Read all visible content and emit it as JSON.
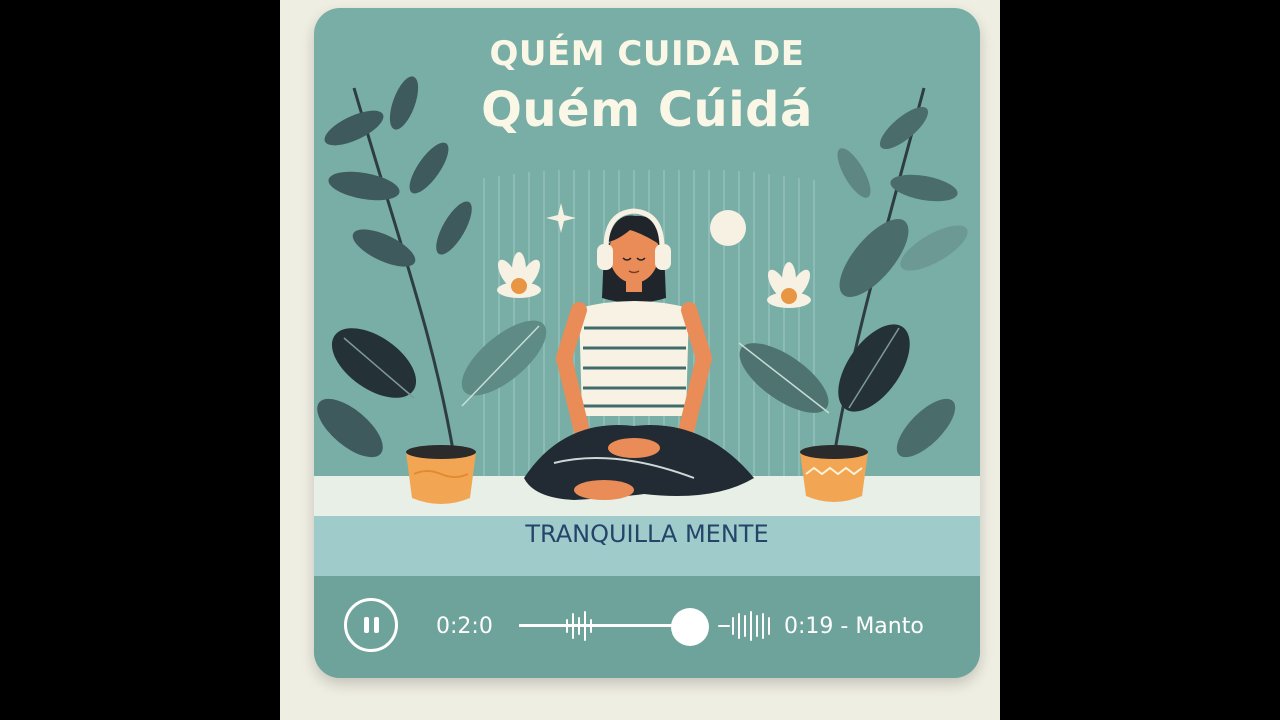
{
  "card": {
    "title_line1": "QUÉM CUIDA DE",
    "title_line2": "Quém Cúidá",
    "brand": "TRANQUILLA MENTE"
  },
  "player": {
    "current_time": "0:2:0",
    "total_time": "0:19 - Manto",
    "state_icon": "pause-icon",
    "progress_fraction": 0.68
  },
  "colors": {
    "card_bg": "#78aea6",
    "title": "#fbf7e6",
    "brand": "#24446a",
    "player_bar": "#6ea39b",
    "shirt": "#f7f2e3",
    "pants": "#222b33",
    "pot": "#f2a654"
  }
}
